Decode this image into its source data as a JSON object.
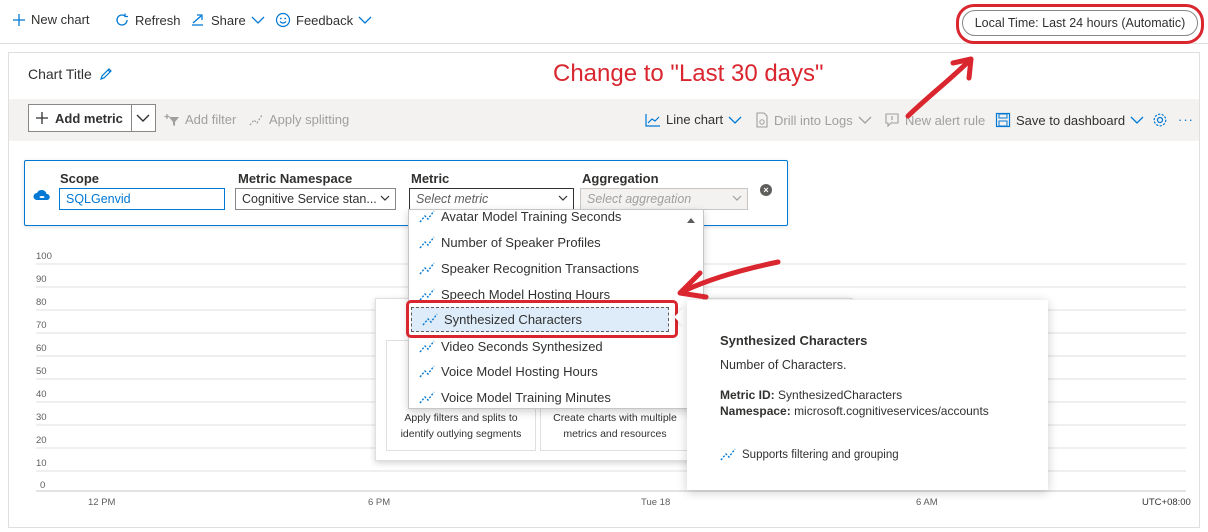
{
  "toolbar": {
    "new_chart": "New chart",
    "refresh": "Refresh",
    "share": "Share",
    "feedback": "Feedback",
    "time_range": "Local Time: Last 24 hours (Automatic)"
  },
  "annotations": {
    "instruction": "Change to \"Last 30 days\"",
    "color": "#d9262f"
  },
  "chart": {
    "title": "Chart Title"
  },
  "chart_toolbar": {
    "add_metric": "Add metric",
    "add_filter": "Add filter",
    "apply_splitting": "Apply splitting",
    "line_chart": "Line chart",
    "drill_into_logs": "Drill into Logs",
    "new_alert_rule": "New alert rule",
    "save_to_dashboard": "Save to dashboard",
    "more": "···"
  },
  "metric_selector": {
    "scope_label": "Scope",
    "scope_value": "SQLGenvid",
    "namespace_label": "Metric Namespace",
    "namespace_value": "Cognitive Service stan...",
    "metric_label": "Metric",
    "metric_placeholder": "Select metric",
    "aggregation_label": "Aggregation",
    "aggregation_placeholder": "Select aggregation"
  },
  "metric_options": [
    "Avatar Model Training Seconds",
    "Number of Speaker Profiles",
    "Speaker Recognition Transactions",
    "Speech Model Hosting Hours",
    "Synthesized Characters",
    "Video Seconds Synthesized",
    "Voice Model Hosting Hours",
    "Voice Model Training Minutes"
  ],
  "selected_metric_index": 4,
  "chart_axes": {
    "y_ticks": [
      "100",
      "90",
      "80",
      "70",
      "60",
      "50",
      "40",
      "30",
      "20",
      "10",
      "0"
    ],
    "x_ticks": [
      "12 PM",
      "6 PM",
      "Tue 18",
      "6 AM"
    ],
    "timezone": "UTC+08:00"
  },
  "empty_state": {
    "card_1": "Apply filters and splits to identify outlying segments",
    "card_2": "Create charts with multiple metrics and resources"
  },
  "tooltip": {
    "title": "Synthesized Characters",
    "description": "Number of Characters.",
    "metric_id_label": "Metric ID:",
    "metric_id_value": "SynthesizedCharacters",
    "namespace_label": "Namespace:",
    "namespace_value": "microsoft.cognitiveservices/accounts",
    "supports": "Supports filtering and grouping"
  },
  "colors": {
    "accent": "#0078d4",
    "annotation": "#d9262f"
  }
}
